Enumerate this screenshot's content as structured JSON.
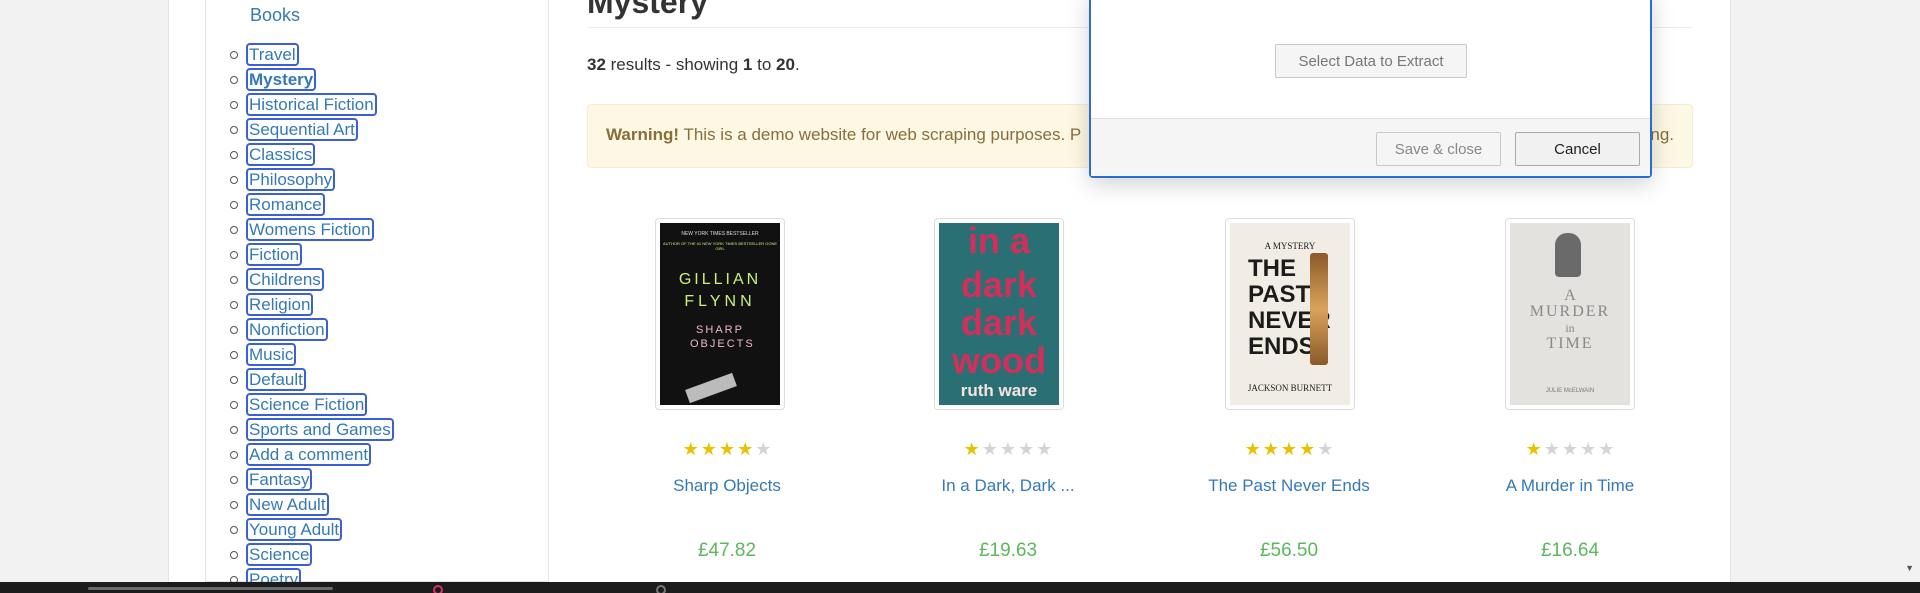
{
  "sidebar": {
    "heading": "Books",
    "categories": [
      {
        "label": "Travel"
      },
      {
        "label": "Mystery"
      },
      {
        "label": "Historical Fiction"
      },
      {
        "label": "Sequential Art"
      },
      {
        "label": "Classics"
      },
      {
        "label": "Philosophy"
      },
      {
        "label": "Romance"
      },
      {
        "label": "Womens Fiction"
      },
      {
        "label": "Fiction"
      },
      {
        "label": "Childrens"
      },
      {
        "label": "Religion"
      },
      {
        "label": "Nonfiction"
      },
      {
        "label": "Music"
      },
      {
        "label": "Default"
      },
      {
        "label": "Science Fiction"
      },
      {
        "label": "Sports and Games"
      },
      {
        "label": "Add a comment"
      },
      {
        "label": "Fantasy"
      },
      {
        "label": "New Adult"
      },
      {
        "label": "Young Adult"
      },
      {
        "label": "Science"
      },
      {
        "label": "Poetry"
      }
    ],
    "active": "Mystery"
  },
  "main": {
    "title": "Mystery",
    "results": {
      "count": "32",
      "text1": " results - showing ",
      "from": "1",
      "to_word": " to ",
      "to": "20",
      "period": "."
    },
    "warning": {
      "bold": "Warning!",
      "text": " This is a demo website for web scraping purposes. P",
      "tail": "ng."
    }
  },
  "products": [
    {
      "title": "Sharp Objects",
      "price": "£47.82",
      "rating": 4,
      "cover": {
        "line1": "NEW YORK TIMES BESTSELLER",
        "line2": "GILLIAN",
        "line3": "FLYNN",
        "line4": "SHARP OBJECTS",
        "line5": "AUTHOR OF THE #1 NEW YORK TIMES BESTSELLER GONE GIRL"
      }
    },
    {
      "title": "In a Dark, Dark ...",
      "price": "£19.63",
      "rating": 1,
      "cover": {
        "line1": "in a",
        "line2": "dark",
        "line3": "dark",
        "line4": "wood",
        "line5": "ruth ware"
      }
    },
    {
      "title": "The Past Never Ends",
      "price": "£56.50",
      "rating": 4,
      "cover": {
        "line1": "A MYSTERY",
        "line2": "THE",
        "line3": "PAST",
        "line4": "NEVER",
        "line5": "ENDS",
        "line6": "JACKSON BURNETT"
      }
    },
    {
      "title": "A Murder in Time",
      "price": "£16.64",
      "rating": 1,
      "cover": {
        "line1": "A",
        "line2": "MURDER",
        "line3": "in",
        "line4": "TIME",
        "line5": "JULIE McELWAIN"
      }
    }
  ],
  "modal": {
    "select_label": "Select Data to Extract",
    "save_label": "Save & close",
    "cancel_label": "Cancel"
  },
  "colors": {
    "link": "#337ab7",
    "price": "#5cb85c",
    "star": "#e6c200",
    "modal_border": "#2b6cd4"
  }
}
